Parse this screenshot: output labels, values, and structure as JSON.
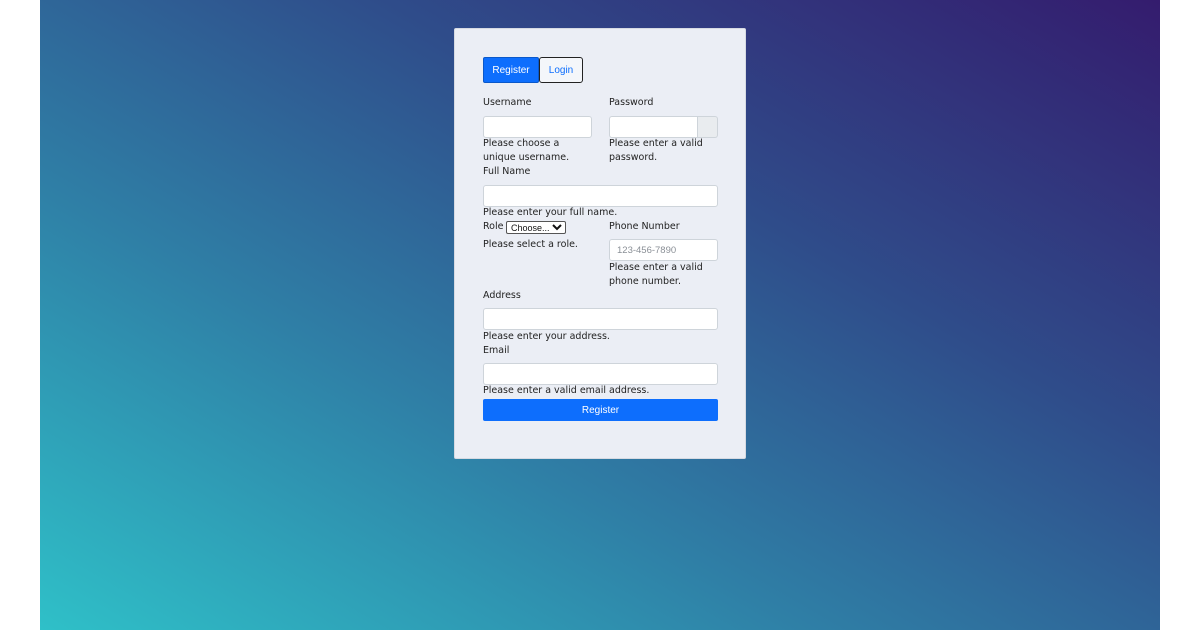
{
  "tabs": {
    "register": "Register",
    "login": "Login"
  },
  "form": {
    "username": {
      "label": "Username",
      "value": "",
      "help": "Please choose a unique username."
    },
    "password": {
      "label": "Password",
      "value": "",
      "help": "Please enter a valid password."
    },
    "full_name": {
      "label": "Full Name",
      "value": "",
      "help": "Please enter your full name."
    },
    "role": {
      "label": "Role",
      "selected": "Choose...",
      "help": "Please select a role."
    },
    "phone": {
      "label": "Phone Number",
      "placeholder": "123-456-7890",
      "help": "Please enter a valid phone number."
    },
    "address": {
      "label": "Address",
      "value": "",
      "help": "Please enter your address."
    },
    "email": {
      "label": "Email",
      "value": "",
      "help": "Please enter a valid email address."
    },
    "submit_label": "Register"
  },
  "colors": {
    "primary": "#0d6efd",
    "card": "#ebeef5"
  }
}
